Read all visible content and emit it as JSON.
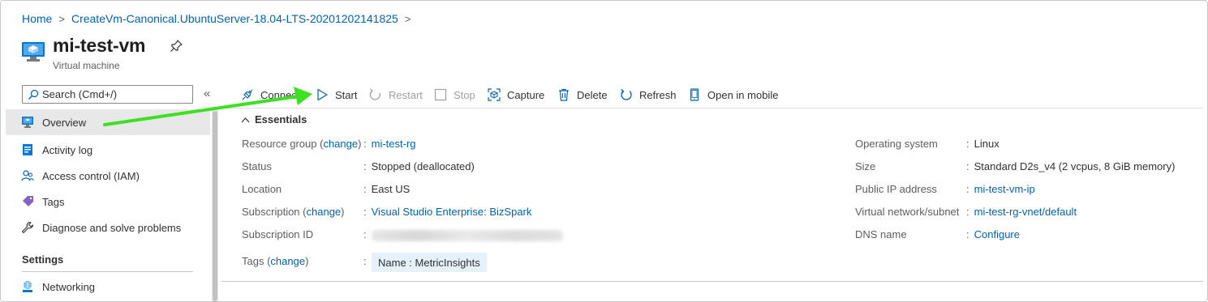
{
  "breadcrumb": {
    "home": "Home",
    "deployment": "CreateVm-Canonical.UbuntuServer-18.04-LTS-20201202141825",
    "separator": ">"
  },
  "header": {
    "title": "mi-test-vm",
    "subtitle": "Virtual machine"
  },
  "search": {
    "placeholder": "Search (Cmd+/)"
  },
  "collapse_label": "«",
  "sidebar": {
    "items": [
      {
        "label": "Overview",
        "icon": "monitor-icon"
      },
      {
        "label": "Activity log",
        "icon": "activity-log-icon"
      },
      {
        "label": "Access control (IAM)",
        "icon": "people-icon"
      },
      {
        "label": "Tags",
        "icon": "tag-icon"
      },
      {
        "label": "Diagnose and solve problems",
        "icon": "wrench-icon"
      }
    ],
    "section": "Settings",
    "section_items": [
      {
        "label": "Networking",
        "icon": "network-icon"
      }
    ]
  },
  "toolbar": {
    "connect": "Connect",
    "start": "Start",
    "restart": "Restart",
    "stop": "Stop",
    "capture": "Capture",
    "delete": "Delete",
    "refresh": "Refresh",
    "open_mobile": "Open in mobile"
  },
  "essentials": {
    "heading": "Essentials",
    "left": [
      {
        "key": "Resource group",
        "change": "change",
        "value": "mi-test-rg",
        "link": true
      },
      {
        "key": "Status",
        "value": "Stopped (deallocated)",
        "link": false
      },
      {
        "key": "Location",
        "value": "East US",
        "link": false
      },
      {
        "key": "Subscription",
        "change": "change",
        "value": "Visual Studio Enterprise: BizSpark",
        "link": true
      },
      {
        "key": "Subscription ID",
        "value": "",
        "link": false
      },
      {
        "key": "Tags",
        "change": "change",
        "value": "Name : MetricInsights",
        "link": false
      }
    ],
    "right": [
      {
        "key": "Operating system",
        "value": "Linux",
        "link": false
      },
      {
        "key": "Size",
        "value": "Standard D2s_v4 (2 vcpus, 8 GiB memory)",
        "link": false
      },
      {
        "key": "Public IP address",
        "value": "mi-test-vm-ip",
        "link": true
      },
      {
        "key": "Virtual network/subnet",
        "value": "mi-test-rg-vnet/default",
        "link": true
      },
      {
        "key": "DNS name",
        "value": "Configure",
        "link": true
      }
    ]
  },
  "colors": {
    "link": "#0063b1",
    "accent": "#0078d4",
    "arrow": "#3ee023",
    "active_bg": "#e8e8e8",
    "tag_bg": "#e5f1fb"
  }
}
